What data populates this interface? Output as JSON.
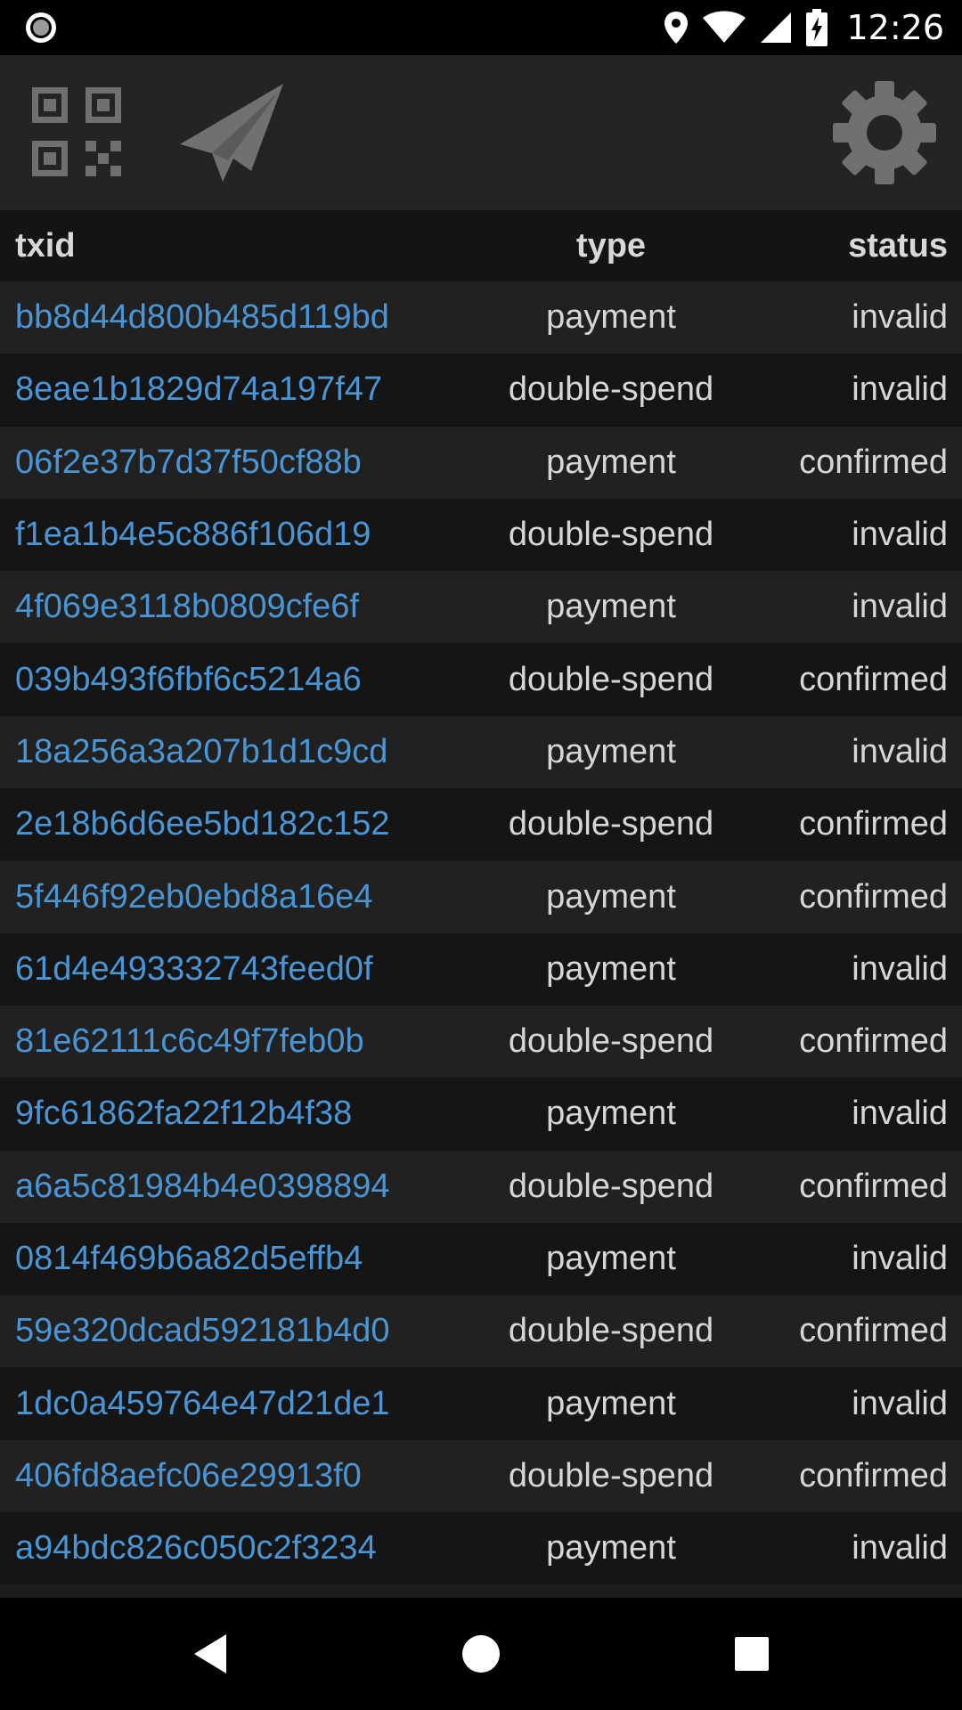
{
  "status_bar": {
    "time": "12:26",
    "icons": [
      "record-icon",
      "location-icon",
      "wifi-icon",
      "signal-icon",
      "battery-charging-icon"
    ]
  },
  "toolbar": {
    "icons": [
      "qr-code-icon",
      "send-icon",
      "settings-gear-icon"
    ]
  },
  "colors": {
    "link": "#4b95d4",
    "text": "#d6d6d6",
    "row_even": "#212121",
    "row_odd": "#151515",
    "toolbar": "#242424",
    "icon": "#707070"
  },
  "table": {
    "headers": {
      "txid": "txid",
      "type": "type",
      "status": "status"
    },
    "rows": [
      {
        "txid": "bb8d44d800b485d119bd",
        "type": "payment",
        "status": "invalid"
      },
      {
        "txid": "8eae1b1829d74a197f47",
        "type": "double-spend",
        "status": "invalid"
      },
      {
        "txid": "06f2e37b7d37f50cf88b",
        "type": "payment",
        "status": "confirmed"
      },
      {
        "txid": "f1ea1b4e5c886f106d19",
        "type": "double-spend",
        "status": "invalid"
      },
      {
        "txid": "4f069e3118b0809cfe6f",
        "type": "payment",
        "status": "invalid"
      },
      {
        "txid": "039b493f6fbf6c5214a6",
        "type": "double-spend",
        "status": "confirmed"
      },
      {
        "txid": "18a256a3a207b1d1c9cd",
        "type": "payment",
        "status": "invalid"
      },
      {
        "txid": "2e18b6d6ee5bd182c152",
        "type": "double-spend",
        "status": "confirmed"
      },
      {
        "txid": "5f446f92eb0ebd8a16e4",
        "type": "payment",
        "status": "confirmed"
      },
      {
        "txid": "61d4e493332743feed0f",
        "type": "payment",
        "status": "invalid"
      },
      {
        "txid": "81e62111c6c49f7feb0b",
        "type": "double-spend",
        "status": "confirmed"
      },
      {
        "txid": "9fc61862fa22f12b4f38",
        "type": "payment",
        "status": "invalid"
      },
      {
        "txid": "a6a5c81984b4e0398894",
        "type": "double-spend",
        "status": "confirmed"
      },
      {
        "txid": "0814f469b6a82d5effb4",
        "type": "payment",
        "status": "invalid"
      },
      {
        "txid": "59e320dcad592181b4d0",
        "type": "double-spend",
        "status": "confirmed"
      },
      {
        "txid": "1dc0a459764e47d21de1",
        "type": "payment",
        "status": "invalid"
      },
      {
        "txid": "406fd8aefc06e29913f0",
        "type": "double-spend",
        "status": "confirmed"
      },
      {
        "txid": "a94bdc826c050c2f3234",
        "type": "payment",
        "status": "invalid"
      }
    ]
  },
  "nav_bar": {
    "icons": [
      "back-icon",
      "home-icon",
      "recents-icon"
    ]
  }
}
